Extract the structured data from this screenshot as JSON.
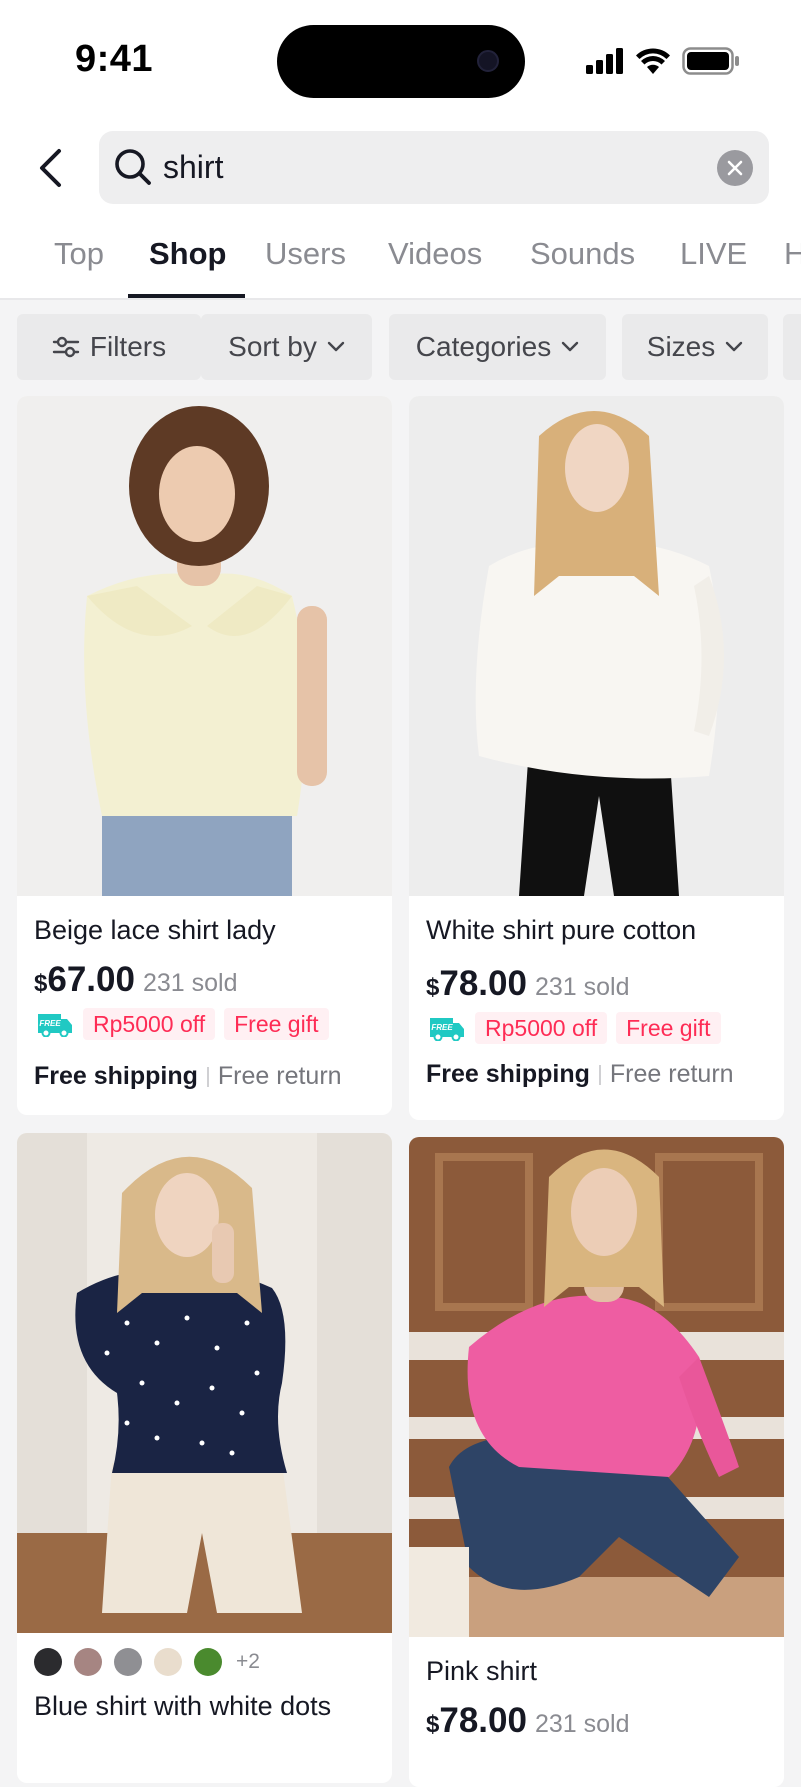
{
  "status_bar": {
    "time": "9:41"
  },
  "search": {
    "query": "shirt"
  },
  "tabs": [
    {
      "label": "Top",
      "active": false
    },
    {
      "label": "Shop",
      "active": true
    },
    {
      "label": "Users",
      "active": false
    },
    {
      "label": "Videos",
      "active": false
    },
    {
      "label": "Sounds",
      "active": false
    },
    {
      "label": "LIVE",
      "active": false
    },
    {
      "label": "H",
      "active": false
    }
  ],
  "filters": {
    "filters_label": "Filters",
    "sort_label": "Sort by",
    "categories_label": "Categories",
    "sizes_label": "Sizes"
  },
  "products": [
    {
      "title": "Beige lace shirt lady",
      "currency": "$",
      "price": "67.00",
      "sold": "231 sold",
      "discount": "Rp5000 off",
      "gift": "Free gift",
      "shipping": "Free shipping",
      "returns": "Free return",
      "free_badge": "FREE"
    },
    {
      "title": "White shirt pure cotton",
      "currency": "$",
      "price": "78.00",
      "sold": "231 sold",
      "discount": "Rp5000 off",
      "gift": "Free gift",
      "shipping": "Free shipping",
      "returns": "Free return",
      "free_badge": "FREE"
    },
    {
      "title": "Blue shirt with white dots",
      "color_swatches": [
        "#2B2B2E",
        "#A68582",
        "#8F8F93",
        "#E9DDCD",
        "#4A8A2E"
      ],
      "more_colors": "+2"
    },
    {
      "title": "Pink shirt",
      "currency": "$",
      "price": "78.00",
      "sold": "231 sold"
    }
  ],
  "colors": {
    "accent_red": "#FE2C55",
    "free_badge_teal": "#20C9C3",
    "text_primary": "#161823",
    "text_secondary": "#8A8B91"
  }
}
